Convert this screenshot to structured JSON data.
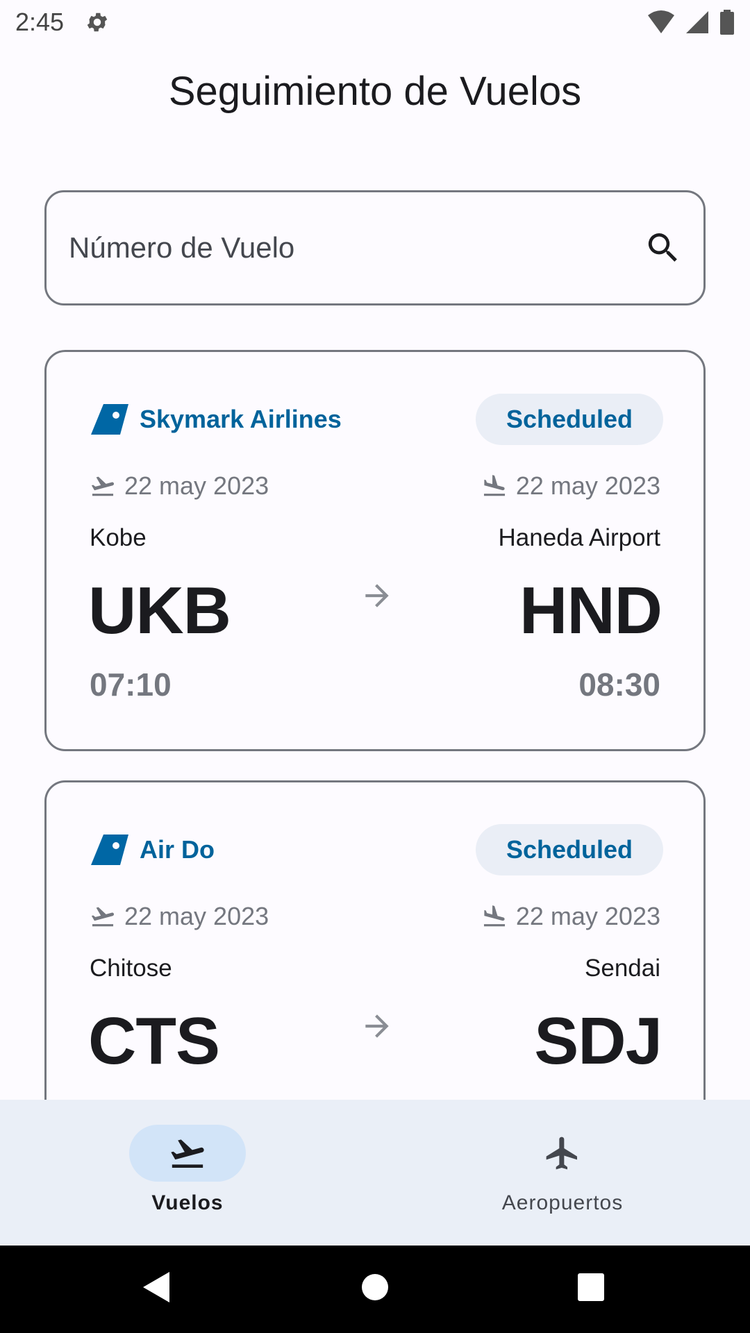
{
  "status_bar": {
    "time": "2:45"
  },
  "page": {
    "title": "Seguimiento de Vuelos"
  },
  "search": {
    "placeholder": "Número de Vuelo",
    "value": ""
  },
  "flights": [
    {
      "airline": "Skymark Airlines",
      "status": "Scheduled",
      "departure": {
        "date": "22 may 2023",
        "city": "Kobe",
        "code": "UKB",
        "time": "07:10"
      },
      "arrival": {
        "date": "22 may 2023",
        "city": "Haneda Airport",
        "code": "HND",
        "time": "08:30"
      }
    },
    {
      "airline": "Air Do",
      "status": "Scheduled",
      "departure": {
        "date": "22 may 2023",
        "city": "Chitose",
        "code": "CTS",
        "time": ""
      },
      "arrival": {
        "date": "22 may 2023",
        "city": "Sendai",
        "code": "SDJ",
        "time": ""
      }
    }
  ],
  "bottom_nav": {
    "items": [
      {
        "label": "Vuelos",
        "icon": "flight-takeoff-icon",
        "active": true
      },
      {
        "label": "Aeropuertos",
        "icon": "airplane-icon",
        "active": false
      }
    ]
  },
  "colors": {
    "accent": "#00639b",
    "chip_bg": "#eaeef6",
    "nav_bg": "#eaeff7",
    "nav_active_pill": "#d2e4f8",
    "outline": "#74777f"
  }
}
